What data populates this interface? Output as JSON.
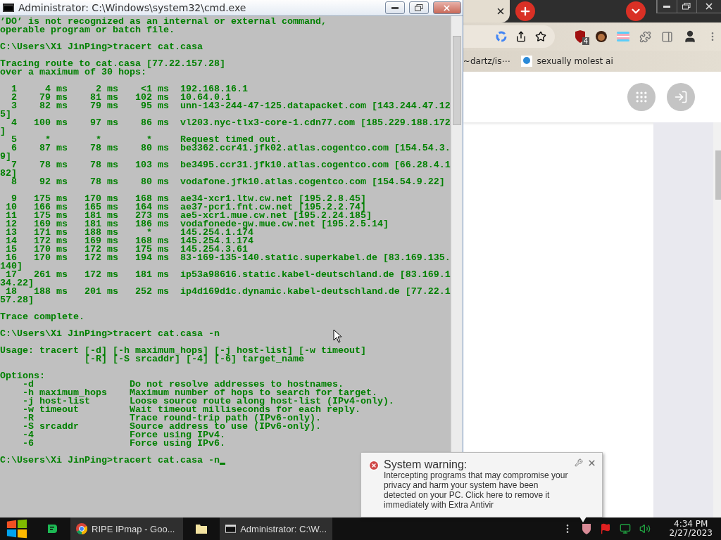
{
  "console_window": {
    "title": "Administrator: C:\\Windows\\system32\\cmd.exe",
    "blocks": [
      [
        "’DO’ is not recognized as an internal or external command,",
        "operable program or batch file."
      ],
      [
        "C:\\Users\\Xi JinPing>tracert cat.casa"
      ],
      [
        "Tracing route to cat.casa [77.22.157.28]",
        "over a maximum of 30 hops:"
      ],
      [
        "  1     4 ms     2 ms    <1 ms  192.168.16.1",
        "  2    79 ms    81 ms   102 ms  10.64.0.1",
        "  3    82 ms    79 ms    95 ms  unn-143-244-47-125.datapacket.com [143.244.47.12",
        "5]",
        "  4   100 ms    97 ms    86 ms  vl203.nyc-tlx3-core-1.cdn77.com [185.229.188.172",
        "]",
        "  5     *        *        *     Request timed out.",
        "  6    87 ms    78 ms    80 ms  be3362.ccr41.jfk02.atlas.cogentco.com [154.54.3.",
        "9]",
        "  7    78 ms    78 ms   103 ms  be3495.ccr31.jfk10.atlas.cogentco.com [66.28.4.1",
        "82]",
        "  8    92 ms    78 ms    80 ms  vodafone.jfk10.atlas.cogentco.com [154.54.9.22]"
      ],
      [
        "  9   175 ms   170 ms   168 ms  ae34-xcr1.ltw.cw.net [195.2.8.45]",
        " 10   166 ms   165 ms   164 ms  ae37-pcr1.fnt.cw.net [195.2.2.74]",
        " 11   175 ms   181 ms   273 ms  ae5-xcr1.mue.cw.net [195.2.24.185]",
        " 12   169 ms   181 ms   186 ms  vodafonede-gw.mue.cw.net [195.2.5.14]",
        " 13   171 ms   188 ms     *     145.254.1.174",
        " 14   172 ms   169 ms   168 ms  145.254.1.174",
        " 15   170 ms   172 ms   175 ms  145.254.3.61",
        " 16   170 ms   172 ms   194 ms  83-169-135-140.static.superkabel.de [83.169.135.",
        "140]",
        " 17   261 ms   172 ms   181 ms  ip53a98616.static.kabel-deutschland.de [83.169.1",
        "34.22]",
        " 18   188 ms   201 ms   252 ms  ip4d169d1c.dynamic.kabel-deutschland.de [77.22.1",
        "57.28]"
      ],
      [
        "Trace complete."
      ],
      [
        "C:\\Users\\Xi JinPing>tracert cat.casa -n"
      ],
      [
        "Usage: tracert [-d] [-h maximum_hops] [-j host-list] [-w timeout]",
        "               [-R] [-S srcaddr] [-4] [-6] target_name"
      ],
      [
        "Options:",
        "    -d                 Do not resolve addresses to hostnames.",
        "    -h maximum_hops    Maximum number of hops to search for target.",
        "    -j host-list       Loose source route along host-list (IPv4-only).",
        "    -w timeout         Wait timeout milliseconds for each reply.",
        "    -R                 Trace round-trip path (IPv6-only).",
        "    -S srcaddr         Source address to use (IPv6-only).",
        "    -4                 Force using IPv4.",
        "    -6                 Force using IPv6."
      ],
      [
        "C:\\Users\\Xi JinPing>tracert cat.casa -n"
      ]
    ]
  },
  "browser": {
    "extension_badge": "4",
    "bookmarks": [
      "~dartz/is⋯",
      "sexually molest ai"
    ]
  },
  "notification": {
    "title": "System warning:",
    "message": "Intercepting programs that may compromise your privacy and harm your system have been detected on your PC. Click here to remove it immediately with Extra Antivir"
  },
  "taskbar": {
    "tasks": [
      {
        "kind": "app",
        "open": false
      },
      {
        "kind": "chrome",
        "label": "RIPE IPmap - Goo...",
        "open": true
      },
      {
        "kind": "folder",
        "open": false
      },
      {
        "kind": "console",
        "label": "Administrator: C:\\W...",
        "open": true
      }
    ],
    "clock": {
      "time": "4:34 PM",
      "date": "2/27/2023"
    }
  }
}
